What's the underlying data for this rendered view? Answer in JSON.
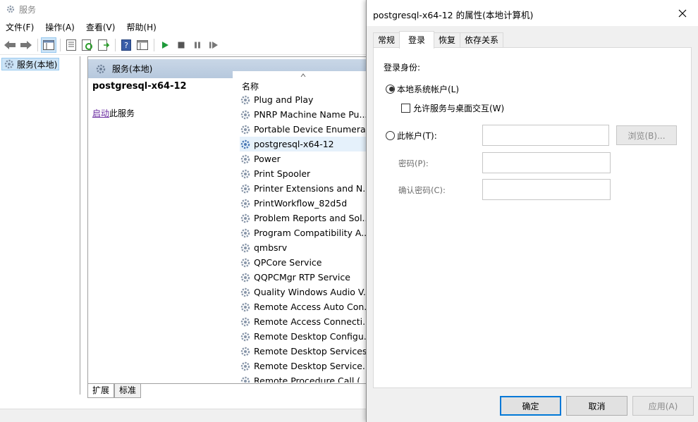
{
  "bg_window": {
    "title": "服务",
    "menu": [
      "文件(F)",
      "操作(A)",
      "查看(V)",
      "帮助(H)"
    ],
    "tree_item": "服务(本地)",
    "header": "服务(本地)",
    "selected_service": "postgresql-x64-12",
    "action_link": "启动",
    "action_suffix": "此服务",
    "column_name": "名称",
    "services": [
      "Plug and Play",
      "PNRP Machine Name Pu...",
      "Portable Device Enumera...",
      "postgresql-x64-12",
      "Power",
      "Print Spooler",
      "Printer Extensions and N...",
      "PrintWorkflow_82d5d",
      "Problem Reports and Sol...",
      "Program Compatibility A...",
      "qmbsrv",
      "QPCore Service",
      "QQPCMgr RTP Service",
      "Quality Windows Audio V...",
      "Remote Access Auto Con...",
      "Remote Access Connecti...",
      "Remote Desktop Configu...",
      "Remote Desktop Services",
      "Remote Desktop Service...",
      "Remote Procedure Call ("
    ],
    "selected_index": 3,
    "bottom_tabs": [
      "扩展",
      "标准"
    ]
  },
  "dialog": {
    "title": "postgresql-x64-12 的属性(本地计算机)",
    "tabs": [
      "常规",
      "登录",
      "恢复",
      "依存关系"
    ],
    "active_tab": 1,
    "logon_as": "登录身份:",
    "local_system": "本地系统帐户(L)",
    "allow_desktop": "允许服务与桌面交互(W)",
    "this_account": "此帐户(T):",
    "browse": "浏览(B)...",
    "password": "密码(P):",
    "confirm_password": "确认密码(C):",
    "ok": "确定",
    "cancel": "取消",
    "apply": "应用(A)"
  }
}
